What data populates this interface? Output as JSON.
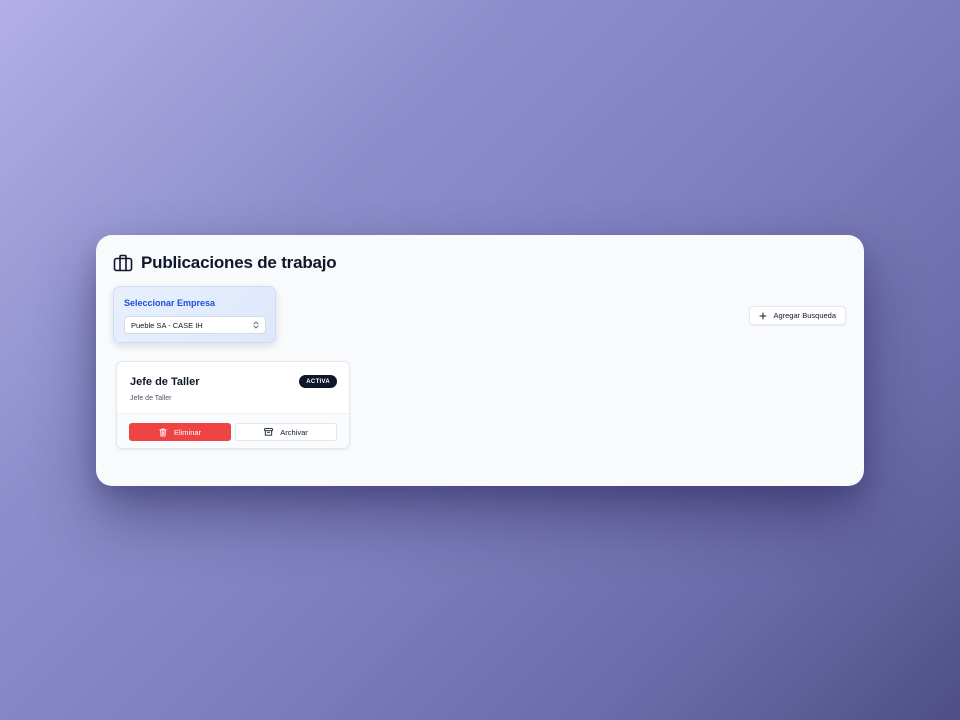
{
  "header": {
    "icon": "briefcase-icon",
    "title": "Publicaciones de trabajo"
  },
  "company_selector": {
    "label": "Seleccionar Empresa",
    "selected_value": "Pueble SA - CASE IH",
    "icon": "chevron-up-down-icon"
  },
  "toolbar": {
    "add_label": "Agregar Busqueda",
    "add_icon": "plus-icon"
  },
  "job_posts": [
    {
      "title": "Jefe de Taller",
      "subtitle": "Jefe de Taller",
      "status": "ACTIVA",
      "delete_label": "Eliminar",
      "delete_icon": "trash-icon",
      "archive_label": "Archivar",
      "archive_icon": "archive-icon"
    }
  ],
  "colors": {
    "delete": "#ef4444",
    "badge": "#0f172a",
    "accent": "#1d4ed8"
  }
}
